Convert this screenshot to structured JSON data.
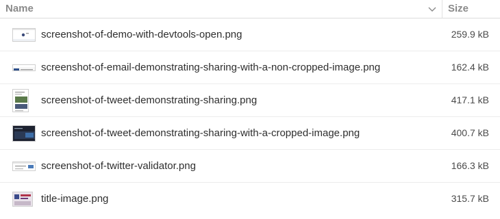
{
  "header": {
    "name_label": "Name",
    "size_label": "Size",
    "sort_icon": "chevron-down-icon"
  },
  "files": [
    {
      "name": "screenshot-of-demo-with-devtools-open.png",
      "size": "259.9 kB"
    },
    {
      "name": "screenshot-of-email-demonstrating-sharing-with-a-non-cropped-image.png",
      "size": "162.4 kB"
    },
    {
      "name": "screenshot-of-tweet-demonstrating-sharing.png",
      "size": "417.1 kB"
    },
    {
      "name": "screenshot-of-tweet-demonstrating-sharing-with-a-cropped-image.png",
      "size": "400.7 kB"
    },
    {
      "name": "screenshot-of-twitter-validator.png",
      "size": "166.3 kB"
    },
    {
      "name": "title-image.png",
      "size": "315.7 kB"
    }
  ],
  "colors": {
    "header_text": "#8a8a8a",
    "row_text": "#2e2e2e",
    "divider": "#ececec"
  }
}
